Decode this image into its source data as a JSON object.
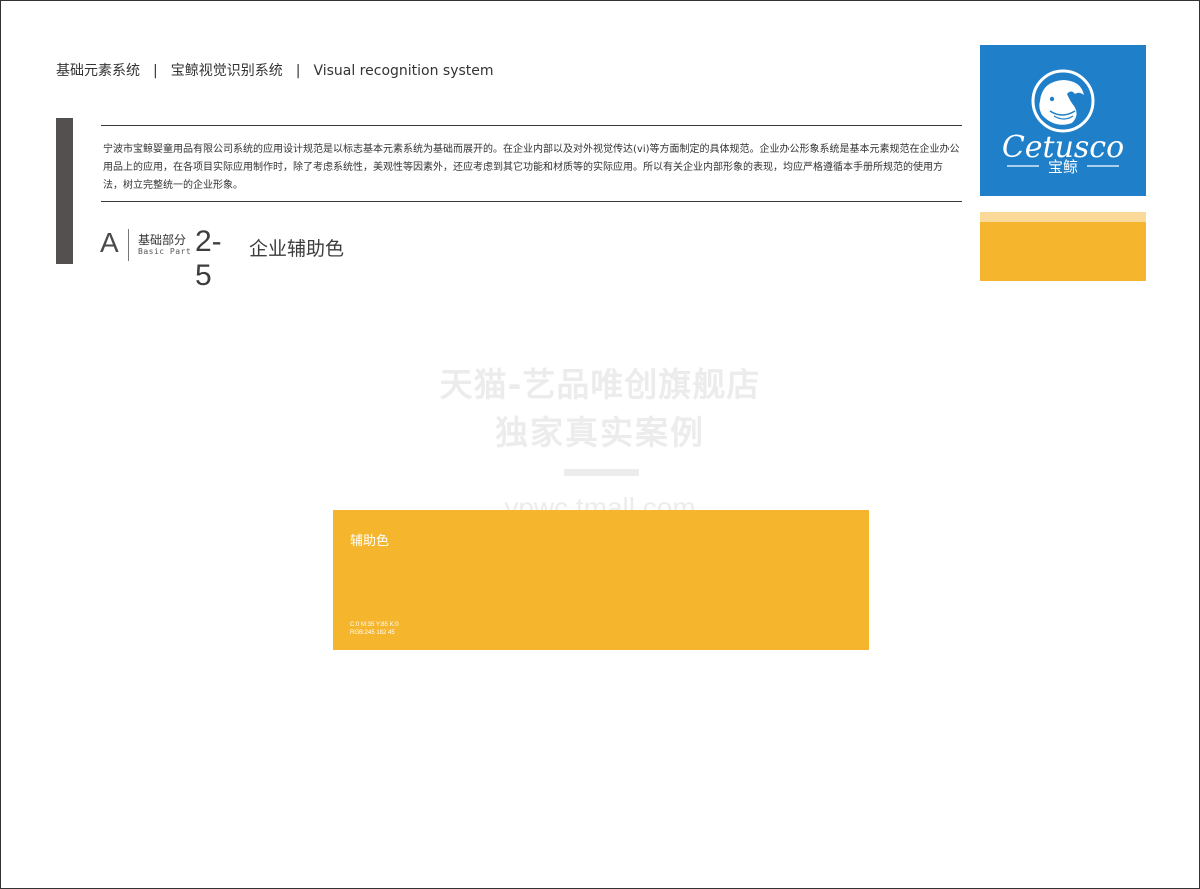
{
  "header": {
    "breadcrumb": [
      "基础元素系统",
      "宝鲸视觉识别系统",
      "Visual recognition system"
    ],
    "separator": "|"
  },
  "intro": {
    "text": "宁波市宝鲸婴童用品有限公司系统的应用设计规范是以标志基本元素系统为基础而展开的。在企业内部以及对外视觉传达(vi)等方面制定的具体规范。企业办公形象系统是基本元素规范在企业办公用品上的应用，在各项目实际应用制作时，除了考虑系统性，美观性等因素外，还应考虑到其它功能和材质等的实际应用。所以有关企业内部形象的表现，均应严格遵循本手册所规范的使用方法，树立完整统一的企业形象。"
  },
  "section": {
    "letter": "A",
    "part_cn": "基础部分",
    "part_en": "Basic Part",
    "number": "2-5",
    "title": "企业辅助色"
  },
  "logo": {
    "wordmark": "Cetusco",
    "brand_cn": "宝鲸",
    "background": "#1f7fc8",
    "icon": "whale-circle-icon"
  },
  "color_strips": {
    "light": "#fad99a",
    "main": "#f5b62d"
  },
  "watermark": {
    "line1": "天猫-艺品唯创旗舰店",
    "line2": "独家真实案例",
    "line3": "ypwc.tmall.com"
  },
  "swatch": {
    "name": "辅助色",
    "cmyk": "C:0 M:35 Y:85 K:0",
    "rgb": "RGB:245 182 45",
    "color": "#f5b62d"
  }
}
